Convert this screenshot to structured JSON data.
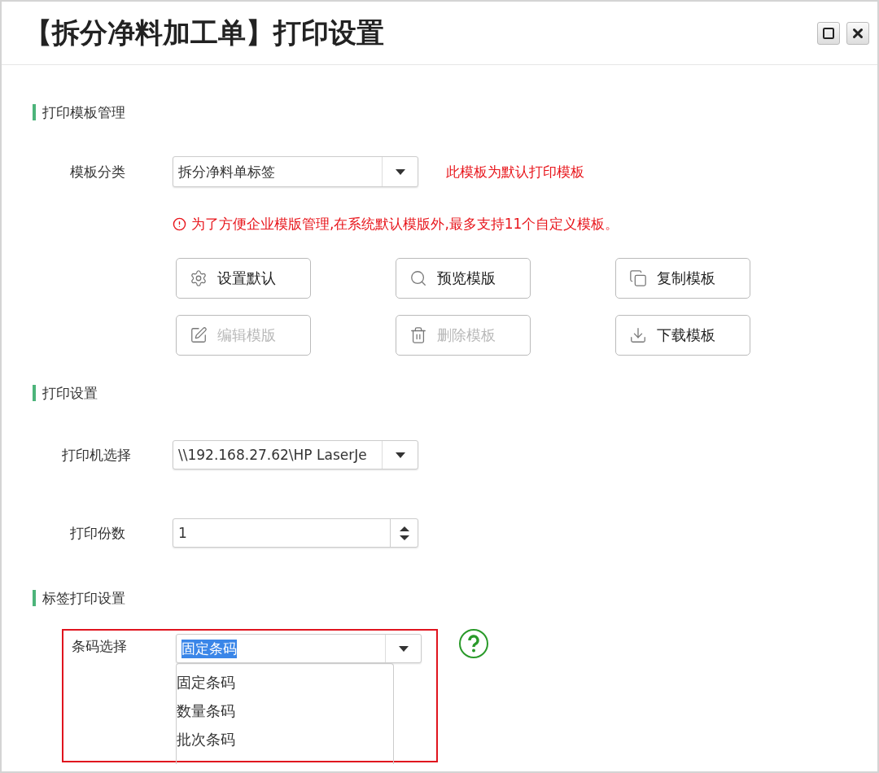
{
  "window": {
    "title": "【拆分净料加工单】打印设置"
  },
  "template_section": {
    "heading": "打印模板管理",
    "category_label": "模板分类",
    "category_value": "拆分净料单标签",
    "default_note": "此模板为默认打印模板",
    "warning": "为了方便企业模版管理,在系统默认模版外,最多支持11个自定义模板。",
    "buttons": [
      {
        "label": "设置默认",
        "disabled": false
      },
      {
        "label": "预览模版",
        "disabled": false
      },
      {
        "label": "复制模板",
        "disabled": false
      },
      {
        "label": "编辑模版",
        "disabled": true
      },
      {
        "label": "删除模板",
        "disabled": true
      },
      {
        "label": "下载模板",
        "disabled": false
      }
    ]
  },
  "print_section": {
    "heading": "打印设置",
    "printer_label": "打印机选择",
    "printer_value": "\\\\192.168.27.62\\HP LaserJe",
    "copies_label": "打印份数",
    "copies_value": "1"
  },
  "label_section": {
    "heading": "标签打印设置",
    "barcode_label": "条码选择",
    "barcode_value": "固定条码",
    "barcode_text_selected": true,
    "options": [
      "固定条码",
      "数量条码",
      "批次条码"
    ]
  }
}
